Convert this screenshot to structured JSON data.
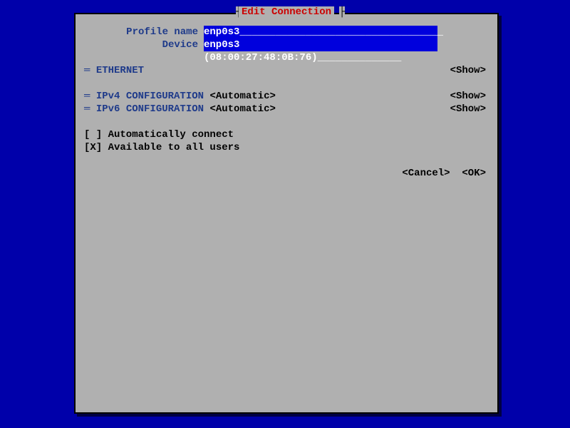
{
  "dialog": {
    "title": "Edit Connection",
    "rule_vert": "┤",
    "rule_vert2": "├"
  },
  "fields": {
    "profile_name_label": "Profile name",
    "profile_name_value": "enp0s3__________________________________",
    "device_label": "Device",
    "device_value": "enp0s3 (08:00:27:48:0B:76)______________"
  },
  "sections": {
    "ethernet": {
      "prefix": "═",
      "label": "ETHERNET",
      "show": "<Show>"
    },
    "ipv4": {
      "prefix": "═",
      "label": "IPv4 CONFIGURATION",
      "value": "<Automatic>",
      "show": "<Show>"
    },
    "ipv6": {
      "prefix": "═",
      "label": "IPv6 CONFIGURATION",
      "value": "<Automatic>",
      "show": "<Show>"
    }
  },
  "checkboxes": {
    "auto_connect": "[ ] Automatically connect",
    "all_users": "[X] Available to all users"
  },
  "actions": {
    "cancel": "<Cancel>",
    "ok": "<OK>"
  }
}
